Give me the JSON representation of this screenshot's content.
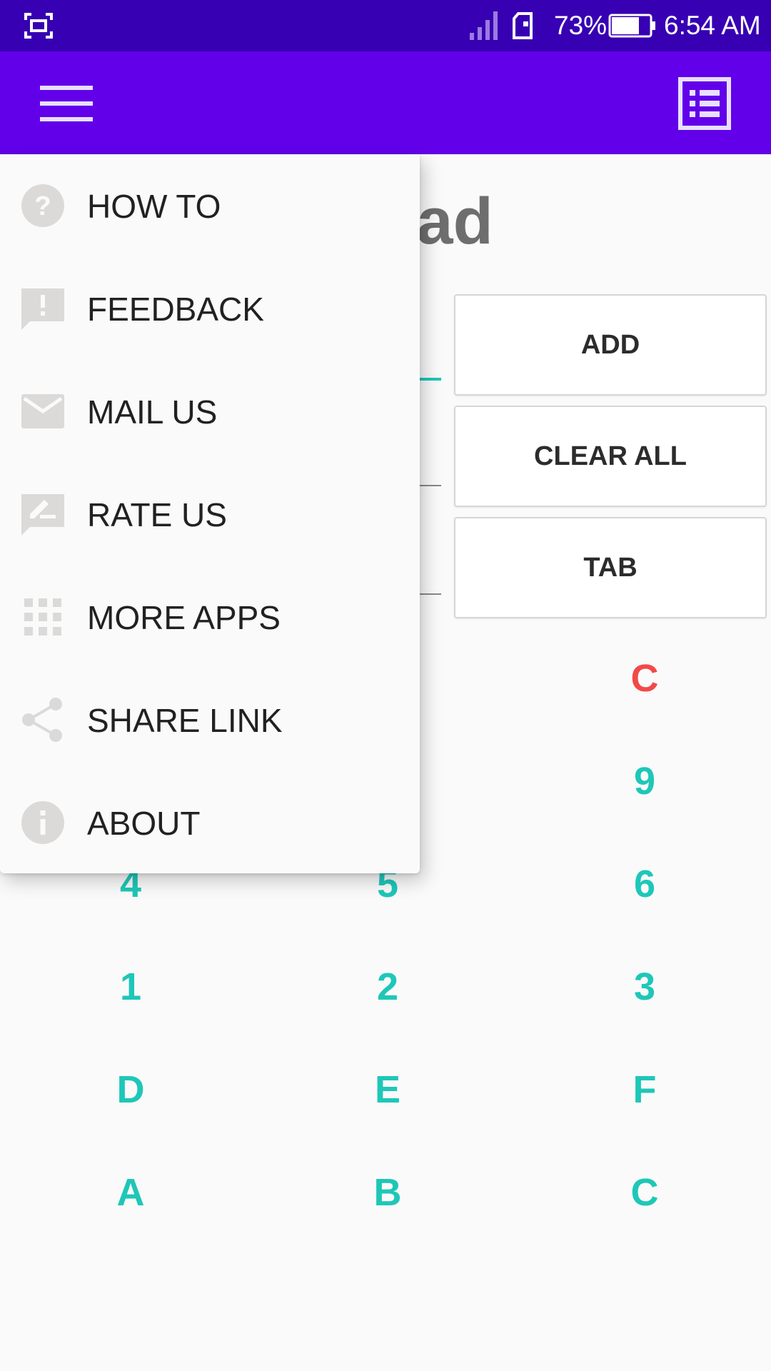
{
  "status_bar": {
    "battery_percent": "73%",
    "battery_level": 0.73,
    "time": "6:54 AM"
  },
  "app_bar": {
    "menu_icon": "hamburger-menu-icon",
    "list_icon": "list-view-icon",
    "color": "#6200ea"
  },
  "main": {
    "title_visible": "otepad",
    "buttons": {
      "add": "ADD",
      "clear_all": "CLEAR ALL",
      "tab": "TAB"
    },
    "keypad": {
      "row1": [
        "C"
      ],
      "row2": [
        "9"
      ],
      "row3": [
        "4",
        "5",
        "6"
      ],
      "row4": [
        "1",
        "2",
        "3"
      ],
      "row5": [
        "D",
        "E",
        "F"
      ],
      "row6": [
        "A",
        "B",
        "C"
      ]
    },
    "accent_color": "#1ec7b8",
    "clear_key_color": "#f44848"
  },
  "drawer": {
    "items": [
      {
        "label": "HOW TO",
        "icon": "help-circle-icon"
      },
      {
        "label": "FEEDBACK",
        "icon": "feedback-icon"
      },
      {
        "label": "MAIL US",
        "icon": "mail-icon"
      },
      {
        "label": "RATE US",
        "icon": "rate-review-icon"
      },
      {
        "label": "MORE APPS",
        "icon": "apps-grid-icon"
      },
      {
        "label": "SHARE LINK",
        "icon": "share-icon"
      },
      {
        "label": "ABOUT",
        "icon": "info-icon"
      }
    ]
  }
}
